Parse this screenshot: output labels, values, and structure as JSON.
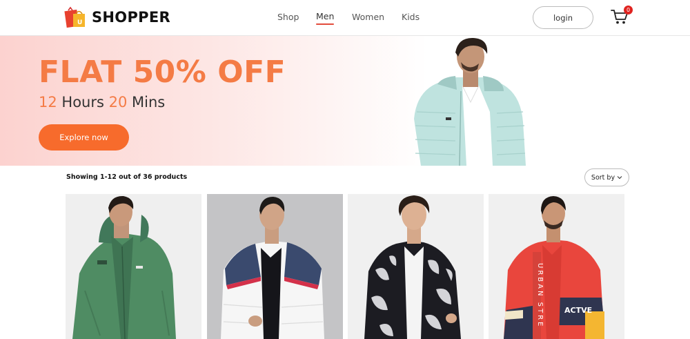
{
  "header": {
    "brand": "SHOPPER",
    "nav": [
      {
        "label": "Shop",
        "active": false
      },
      {
        "label": "Men",
        "active": true
      },
      {
        "label": "Women",
        "active": false
      },
      {
        "label": "Kids",
        "active": false
      }
    ],
    "login_label": "login",
    "cart_count": "0"
  },
  "hero": {
    "headline": "FLAT 50% OFF",
    "timer_hours": "12",
    "timer_hours_label": " Hours ",
    "timer_mins": "20",
    "timer_mins_label": " Mins",
    "cta_label": "Explore now"
  },
  "listing": {
    "showing_text": "Showing 1-12 out of 36 products",
    "sort_label": "Sort by"
  },
  "products": [
    {
      "name": "green-hooded-jacket"
    },
    {
      "name": "white-navy-puffer-jacket"
    },
    {
      "name": "black-white-print-bomber-jacket"
    },
    {
      "name": "red-colorblock-windbreaker",
      "print_vertical": "URBAN STRE",
      "print_chest": "ACTVE"
    }
  ],
  "colors": {
    "accent": "#f47b45",
    "cta": "#f76b2c",
    "nav_underline": "#e24b3b",
    "badge": "#e0231f"
  }
}
